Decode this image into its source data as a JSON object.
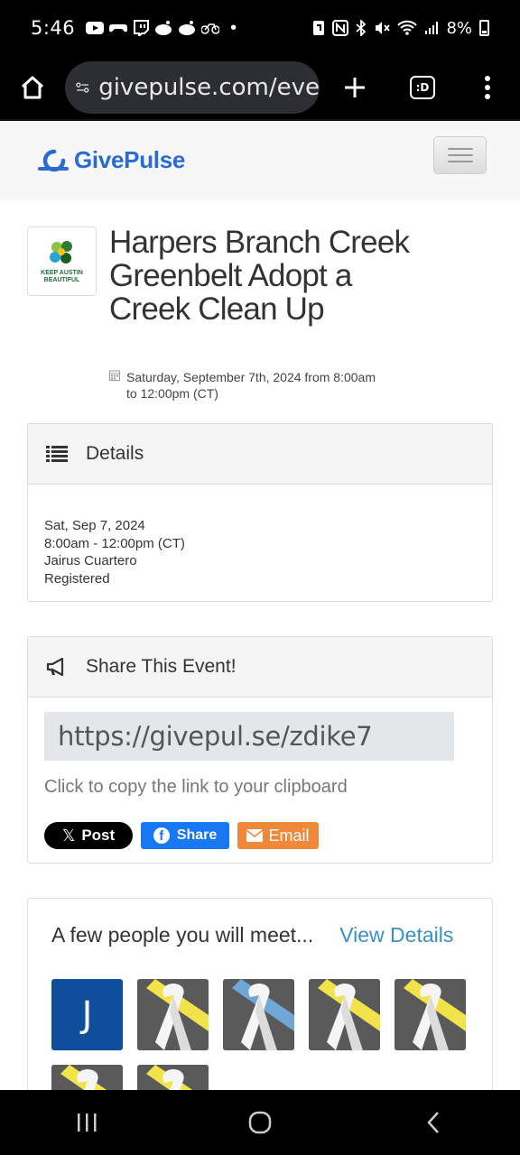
{
  "status_bar": {
    "time": "5:46",
    "battery": "8%",
    "icons": [
      "youtube-icon",
      "gamepad-icon",
      "twitch-icon",
      "reddit-icon",
      "reddit-icon",
      "bike-icon",
      "dot-icon",
      "nfc-icon",
      "bluetooth-icon",
      "mute-icon",
      "wifi-icon",
      "signal-icon"
    ]
  },
  "browser": {
    "url": "givepulse.com/eve",
    "tabs_label": ":D"
  },
  "site": {
    "logo_text": "GivePulse",
    "brand_color": "#2a6bd1"
  },
  "event": {
    "org_logo_text": "KEEP AUSTIN BEAUTIFUL",
    "title": "Harpers Branch Creek Greenbelt Adopt a Creek Clean Up",
    "date_line1": "Saturday, September 7th, 2024 from 8:00am",
    "date_line2": "to 12:00pm (CT)"
  },
  "details": {
    "heading": "Details",
    "date": "Sat, Sep 7, 2024",
    "time": "8:00am - 12:00pm (CT)",
    "name": "Jairus Cuartero",
    "status": "Registered"
  },
  "share": {
    "heading": "Share This Event!",
    "link": "https://givepul.se/zdike7",
    "hint": "Click to copy the link to your clipboard",
    "x_label": "Post",
    "facebook_label": "Share",
    "email_label": "Email"
  },
  "people": {
    "heading": "A few people you will meet...",
    "link_label": "View Details",
    "first_avatar_letter": "J"
  }
}
